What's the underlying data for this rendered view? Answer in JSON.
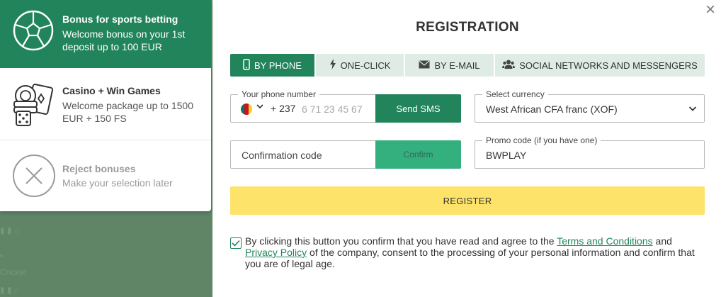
{
  "background_ghost": {
    "line1": "Cricket"
  },
  "bonuses": {
    "sports": {
      "title": "Bonus for sports betting",
      "desc": "Welcome bonus on your 1st deposit up to 100 EUR",
      "icon": "soccer-ball-icon"
    },
    "casino": {
      "title": "Casino + Win Games",
      "desc": "Welcome package up to 1500 EUR + 150 FS",
      "icon": "casino-chips-cards-icon"
    },
    "reject": {
      "title": "Reject bonuses",
      "desc": "Make your selection later",
      "icon": "reject-x-icon"
    }
  },
  "modal": {
    "title": "REGISTRATION",
    "close_icon": "close-icon",
    "tabs": [
      {
        "label": "BY PHONE",
        "icon": "phone-icon",
        "active": true
      },
      {
        "label": "ONE-CLICK",
        "icon": "lightning-icon",
        "active": false
      },
      {
        "label": "BY E-MAIL",
        "icon": "envelope-icon",
        "active": false
      },
      {
        "label": "SOCIAL NETWORKS AND MESSENGERS",
        "icon": "people-icon",
        "active": false
      }
    ],
    "phone": {
      "label": "Your phone number",
      "prefix": "+ 237",
      "placeholder": "6 71 23 45 67",
      "country_flag": "cameroon-flag-icon",
      "send_sms": "Send SMS"
    },
    "currency": {
      "label": "Select currency",
      "value": "West African CFA franc (XOF)"
    },
    "confirmation": {
      "placeholder": "Confirmation code",
      "button": "Confirm"
    },
    "promo": {
      "label": "Promo code (if you have one)",
      "value": "BWPLAY"
    },
    "register": "REGISTER",
    "agreement": {
      "checked": true,
      "text_before": "By clicking this button you confirm that you have read and agree to the ",
      "terms_link": "Terms and Conditions",
      "and": " and ",
      "privacy_link": "Privacy Policy",
      "text_after": " of the company, consent to the processing of your personal information and confirm that you are of legal age."
    }
  },
  "colors": {
    "primary_green": "#22845a",
    "confirm_green": "#33b07e",
    "tab_bg": "#dfece6",
    "register_yellow": "#fde36a",
    "overlay_green": "#5f8466"
  }
}
